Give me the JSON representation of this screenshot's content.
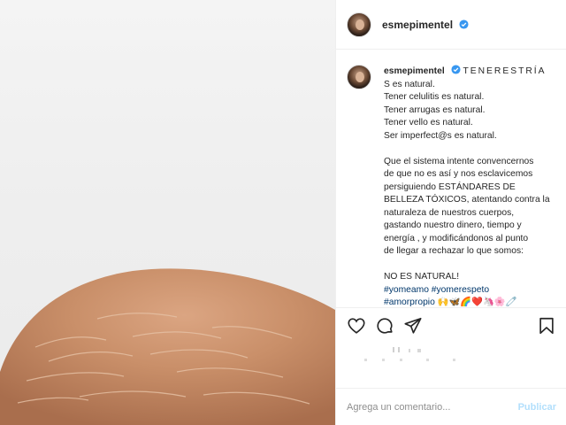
{
  "post": {
    "username": "esmepimentel",
    "verified": true,
    "caption": {
      "username": "esmepimentel",
      "tag": "TENERESTRÍA",
      "lines_1": [
        "S es natural.",
        "Tener celulitis es natural.",
        "Tener arrugas es natural.",
        "Tener vello es natural.",
        "Ser imperfect@s es natural."
      ],
      "lines_2": [
        "Que el sistema intente convencernos",
        "de que no es así y nos esclavicemos",
        "persiguiendo ESTÁNDARES DE",
        "BELLEZA TÓXICOS, atentando contra la",
        "naturaleza de nuestros cuerpos,",
        "gastando nuestro dinero, tiempo y",
        "energía , y modificándonos al punto",
        "de llegar a rechazar lo que somos:"
      ],
      "closing": "NO ES NATURAL!",
      "hashtags_line1": "#yomeamo #yomerespeto",
      "hashtags_line2": "#amorpropio",
      "emojis": "🙌🦋🌈❤️🦄🌸🧷"
    }
  },
  "icons": {
    "like": "heart-icon",
    "comment": "comment-bubble-icon",
    "share": "paper-plane-icon",
    "save": "bookmark-icon",
    "verified": "verified-badge-icon"
  },
  "comment_bar": {
    "placeholder": "Agrega un comentario...",
    "publish_label": "Publicar"
  },
  "colors": {
    "verified": "#3897f0",
    "link": "#00376b",
    "publish_disabled": "#b2dffc",
    "skin": "#c8906a"
  }
}
